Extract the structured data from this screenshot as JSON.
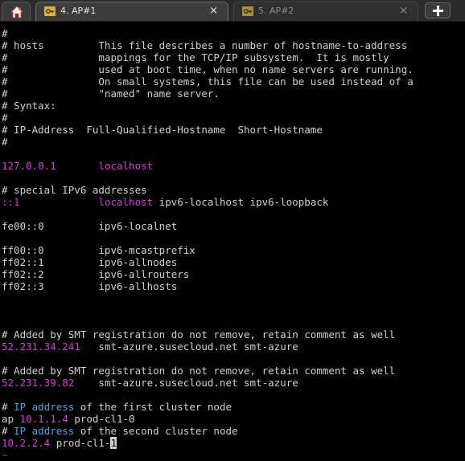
{
  "tabs": [
    {
      "label": "4. AP#1",
      "active": true,
      "close": "×"
    },
    {
      "label": "5. AP#2",
      "active": false,
      "close": "×"
    }
  ],
  "terminal": {
    "lines": [
      [
        {
          "t": "#"
        }
      ],
      [
        {
          "t": "# hosts         This file describes a number of hostname-to-address"
        }
      ],
      [
        {
          "t": "#               mappings for the TCP/IP subsystem.  It is mostly"
        }
      ],
      [
        {
          "t": "#               used at boot time, when no name servers are running."
        }
      ],
      [
        {
          "t": "#               On small systems, this file can be used instead of a"
        }
      ],
      [
        {
          "t": "#               \"named\" name server."
        }
      ],
      [
        {
          "t": "# Syntax:"
        }
      ],
      [
        {
          "t": "#"
        }
      ],
      [
        {
          "t": "# IP-Address  Full-Qualified-Hostname  Short-Hostname"
        }
      ],
      [
        {
          "t": "#"
        }
      ],
      [
        {
          "t": ""
        }
      ],
      [
        {
          "t": "127.0.0.1",
          "c": "ip"
        },
        {
          "t": "       "
        },
        {
          "t": "localhost",
          "c": "ip"
        }
      ],
      [
        {
          "t": ""
        }
      ],
      [
        {
          "t": "# special IPv6 addresses"
        }
      ],
      [
        {
          "t": "::1",
          "c": "ip"
        },
        {
          "t": "             "
        },
        {
          "t": "localhost",
          "c": "ip"
        },
        {
          "t": " ipv6-localhost ipv6-loopback"
        }
      ],
      [
        {
          "t": ""
        }
      ],
      [
        {
          "t": "fe00::0         ipv6-localnet"
        }
      ],
      [
        {
          "t": ""
        }
      ],
      [
        {
          "t": "ff00::0         ipv6-mcastprefix"
        }
      ],
      [
        {
          "t": "ff02::1         ipv6-allnodes"
        }
      ],
      [
        {
          "t": "ff02::2         ipv6-allrouters"
        }
      ],
      [
        {
          "t": "ff02::3         ipv6-allhosts"
        }
      ],
      [
        {
          "t": ""
        }
      ],
      [
        {
          "t": ""
        }
      ],
      [
        {
          "t": ""
        }
      ],
      [
        {
          "t": "# Added by SMT registration do not remove, retain comment as well"
        }
      ],
      [
        {
          "t": "52.231.34.241",
          "c": "ip"
        },
        {
          "t": "   smt-azure.susecloud.net smt-azure"
        }
      ],
      [
        {
          "t": ""
        }
      ],
      [
        {
          "t": "# Added by SMT registration do not remove, retain comment as well"
        }
      ],
      [
        {
          "t": "52.231.39.82",
          "c": "ip"
        },
        {
          "t": "    smt-azure.susecloud.net smt-azure"
        }
      ],
      [
        {
          "t": ""
        }
      ],
      [
        {
          "t": "# "
        },
        {
          "t": "IP address",
          "c": "kw"
        },
        {
          "t": " of the first cluster node"
        }
      ],
      [
        {
          "t": "ap "
        },
        {
          "t": "10.1.1.4",
          "c": "ip"
        },
        {
          "t": " prod-cl1-0"
        }
      ],
      [
        {
          "t": "# "
        },
        {
          "t": "IP address",
          "c": "kw"
        },
        {
          "t": " of the second cluster node"
        }
      ],
      [
        {
          "t": "10.2.2.4",
          "c": "ip"
        },
        {
          "t": " prod-cl1-"
        },
        {
          "t": "1",
          "c": "cursor"
        }
      ],
      [
        {
          "t": "~",
          "c": "tilde"
        }
      ]
    ]
  },
  "colors": {
    "background": "#000000",
    "text": "#d0d0d0",
    "ip_highlight": "#d63ad6",
    "keyword": "#4aa3df",
    "tab_active": "#3c3c3c",
    "tab_inactive": "#2f2f2f"
  },
  "icons": {
    "home": "home-icon",
    "tab": "key-icon",
    "new_tab": "plus-icon"
  }
}
